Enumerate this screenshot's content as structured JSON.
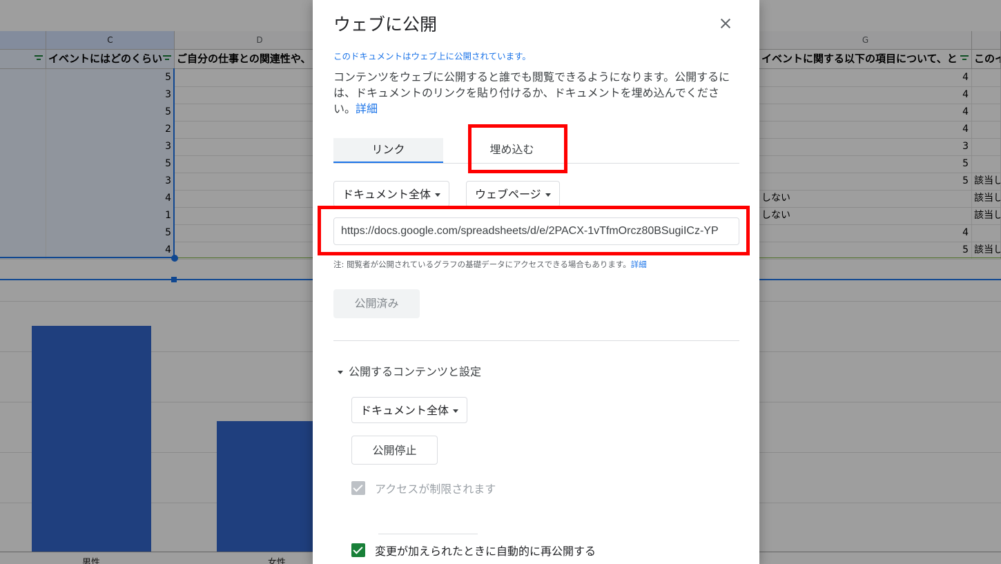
{
  "sheet": {
    "col_letters": [
      "C",
      "D",
      "G"
    ],
    "headers": [
      "イベントにはどのくらい",
      "ご自分の仕事との関連性や、",
      "イベントに関する以下の項目について、と",
      "このイ"
    ],
    "col_c_values": [
      "5",
      "3",
      "5",
      "2",
      "3",
      "5",
      "3",
      "4",
      "1",
      "5",
      "4"
    ],
    "col_g_values": [
      "4",
      "4",
      "4",
      "4",
      "3",
      "5",
      "5",
      "",
      "",
      "4",
      "5"
    ],
    "col_f_partial": [
      "",
      "",
      "",
      "",
      "",
      "",
      "",
      "しない",
      "しない",
      "",
      ""
    ],
    "col_h_partial": [
      "",
      "",
      "",
      "",
      "",
      "",
      "該当し",
      "該当し",
      "該当し",
      "",
      "該当し"
    ],
    "chart_x_labels": [
      "男性",
      "女性"
    ]
  },
  "dialog": {
    "title": "ウェブに公開",
    "status": "このドキュメントはウェブ上に公開されています。",
    "description": "コンテンツをウェブに公開すると誰でも閲覧できるようになります。公開するには、ドキュメントのリンクを貼り付けるか、ドキュメントを埋め込んでください。",
    "description_link": "詳細",
    "tabs": {
      "link": "リンク",
      "embed": "埋め込む"
    },
    "doc_scope": "ドキュメント全体",
    "format": "ウェブページ",
    "url": "https://docs.google.com/spreadsheets/d/e/2PACX-1vTfmOrcz80BSugiICz-YP",
    "note": "注: 閲覧者が公開されているグラフの基礎データにアクセスできる場合もあります。",
    "note_link": "詳細",
    "published_button": "公開済み",
    "section_title": "公開するコンテンツと設定",
    "section_scope": "ドキュメント全体",
    "stop_button": "公開停止",
    "restrict_access": "アクセスが制限されます",
    "auto_republish": "変更が加えられたときに自動的に再公開する"
  },
  "colors": {
    "accent": "#1a73e8",
    "annotation": "#ff0000",
    "check": "#188038",
    "bar": "#3366cc"
  }
}
